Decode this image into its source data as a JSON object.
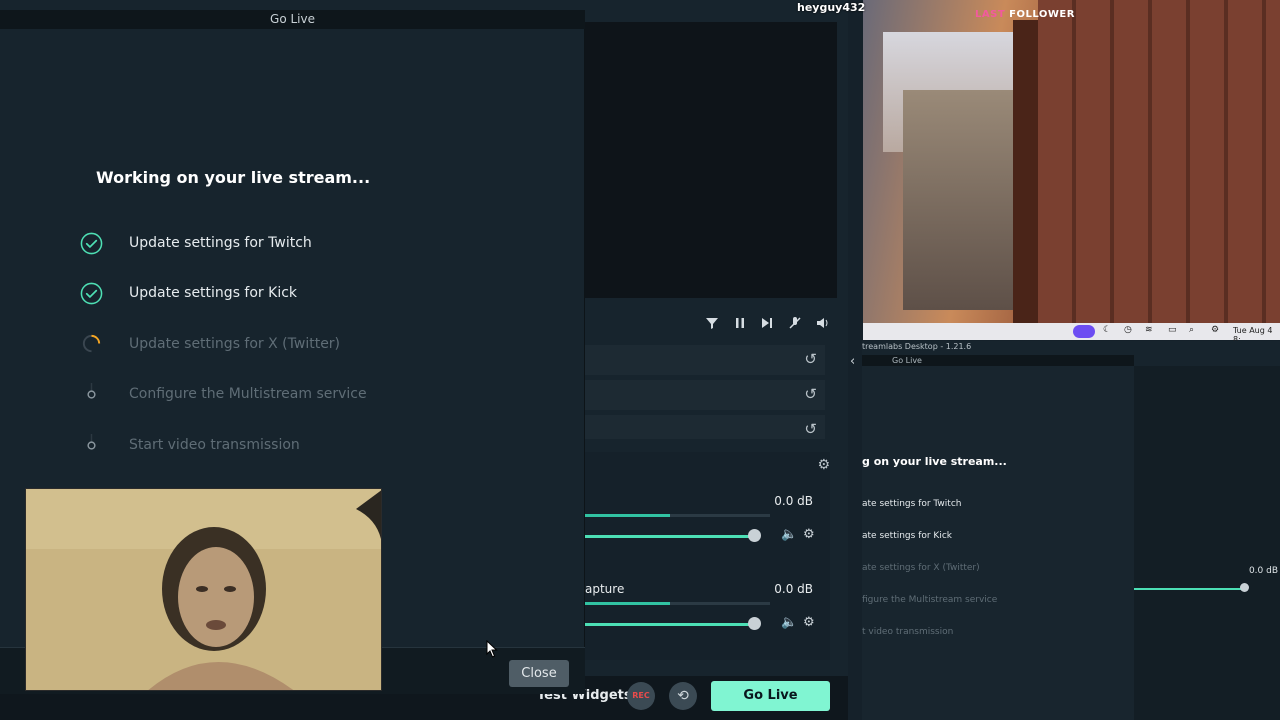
{
  "background_app": {
    "window_title": "Streamlabs Desktop - 1.21.6",
    "source_rows": 3,
    "mixer": {
      "channels": [
        {
          "name": "",
          "level": "0.0 dB"
        },
        {
          "name": "apture",
          "level": "0.0 dB"
        }
      ]
    },
    "footer": {
      "test_widgets": "Test Widgets",
      "rec": "REC",
      "go_live": "Go Live"
    }
  },
  "dialog": {
    "title": "Go Live",
    "heading": "Working on your live stream...",
    "steps": [
      {
        "label": "Update settings for Twitch",
        "state": "done"
      },
      {
        "label": "Update settings for Kick",
        "state": "done"
      },
      {
        "label": "Update settings for X (Twitter)",
        "state": "in-progress"
      },
      {
        "label": "Configure the Multistream service",
        "state": "pending"
      },
      {
        "label": "Start video transmission",
        "state": "pending"
      }
    ],
    "close_button": "Close"
  },
  "stream_preview": {
    "username": "heyguy432",
    "last_follower_a": "LAST",
    "last_follower_b": "FOLLOWER",
    "taskbar_time": "Tue Aug 4  8:",
    "nested": {
      "window_title": "treamlabs Desktop - 1.21.6",
      "dialog_title": "Go Live",
      "heading": "g on your live stream...",
      "steps": [
        "ate settings for Twitch",
        "ate settings for Kick",
        "ate settings for X (Twitter)",
        "figure the Multistream service",
        "t video transmission"
      ],
      "level": "0.0 dB"
    }
  },
  "colors": {
    "accent": "#80f5d2",
    "success": "#4ee0b4",
    "progress": "#f5a623",
    "panel": "#17242d"
  },
  "icons": [
    "check-circle-icon",
    "spinner-icon",
    "pending-dot-icon",
    "filter-icon",
    "pause-icon",
    "skip-icon",
    "mic-mute-icon",
    "speaker-icon",
    "reset-icon",
    "gear-icon",
    "mute-icon",
    "replay-icon",
    "cursor-icon",
    "chevron-left-icon"
  ]
}
